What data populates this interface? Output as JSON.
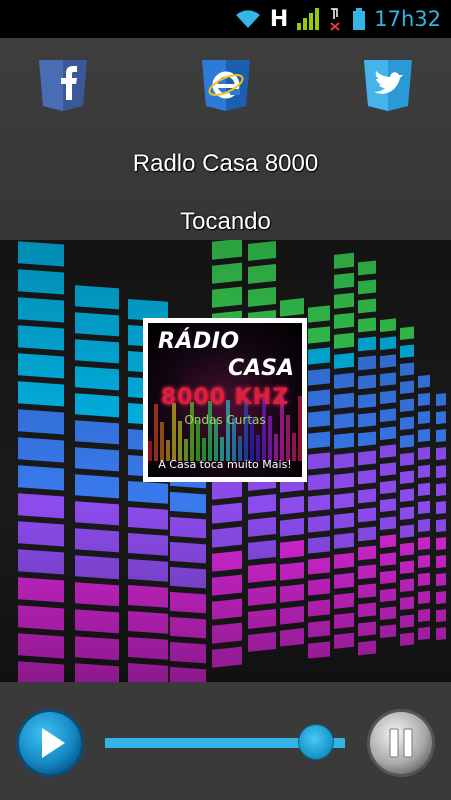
{
  "status_bar": {
    "network_type": "H",
    "clock": "17h32",
    "icons": [
      "wifi-icon",
      "signal-icon",
      "no-sim-icon",
      "battery-icon"
    ]
  },
  "social": {
    "facebook": {
      "icon": "facebook-icon",
      "color": "#3b5998"
    },
    "browser": {
      "icon": "internet-explorer-icon",
      "color": "#1e6fc8"
    },
    "twitter": {
      "icon": "twitter-icon",
      "color": "#3aaae1"
    }
  },
  "station": {
    "name": "Radlo Casa 8000",
    "status": "Tocando"
  },
  "logo": {
    "line1": "RÁDIO",
    "line2": "CASA",
    "frequency": "8000 KHZ",
    "band": "Ondas Curtas",
    "slogan": "A Casa  toca muito Mais!"
  },
  "player": {
    "play_icon": "play-icon",
    "pause_icon": "pause-icon",
    "volume_level": 0.88,
    "accent_color": "#33b5e5"
  }
}
